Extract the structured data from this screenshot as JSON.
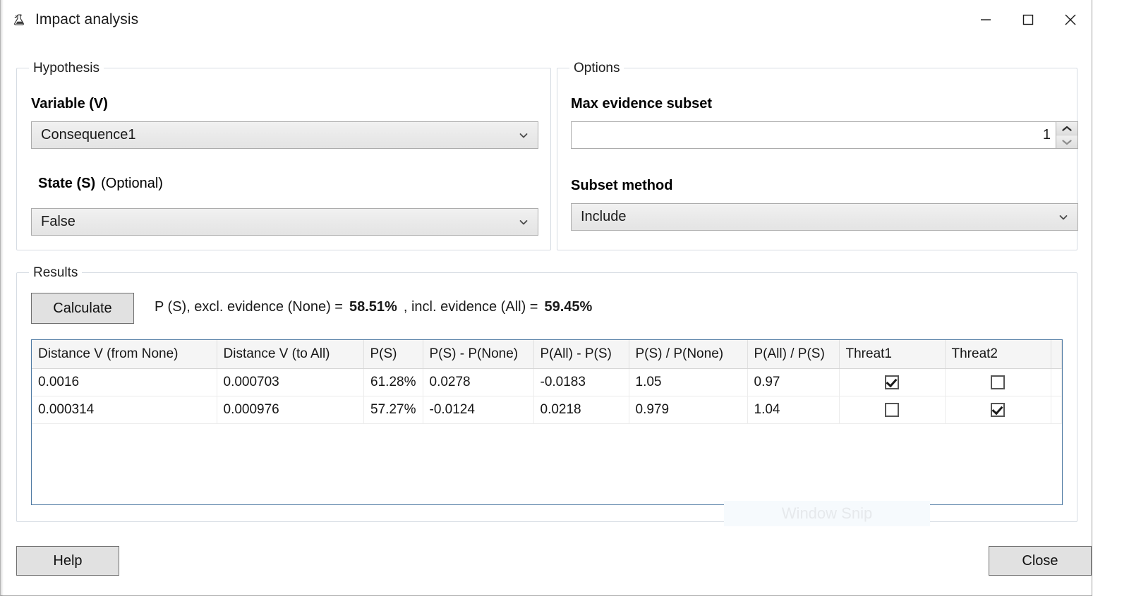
{
  "window": {
    "title": "Impact analysis",
    "icon": "flask-icon",
    "minimize_label": "Minimize",
    "maximize_label": "Maximize",
    "close_label": "Close"
  },
  "hypothesis": {
    "legend": "Hypothesis",
    "variable_label": "Variable (V)",
    "variable_value": "Consequence1",
    "state_label": "State (S)",
    "state_optional": "(Optional)",
    "state_value": "False"
  },
  "options": {
    "legend": "Options",
    "max_subset_label": "Max evidence subset",
    "max_subset_value": "1",
    "subset_method_label": "Subset method",
    "subset_method_value": "Include"
  },
  "results": {
    "legend": "Results",
    "calculate_label": "Calculate",
    "summary_prefix": "P (S), excl. evidence (None) =",
    "excl_value": "58.51%",
    "summary_middle": ", incl. evidence (All) =",
    "incl_value": "59.45%"
  },
  "table": {
    "columns": [
      "Distance V (from None)",
      "Distance V (to All)",
      "P(S)",
      "P(S) - P(None)",
      "P(All) - P(S)",
      "P(S) / P(None)",
      "P(All) / P(S)",
      "Threat1",
      "Threat2",
      ""
    ],
    "rows": [
      {
        "distance_from_none": "0.0016",
        "distance_to_all": "0.000703",
        "p_s": "61.28%",
        "p_s_minus_p_none": "0.0278",
        "p_all_minus_p_s": "-0.0183",
        "p_s_over_p_none": "1.05",
        "p_all_over_p_s": "0.97",
        "threat1": true,
        "threat2": false
      },
      {
        "distance_from_none": "0.000314",
        "distance_to_all": "0.000976",
        "p_s": "57.27%",
        "p_s_minus_p_none": "-0.0124",
        "p_all_minus_p_s": "0.0218",
        "p_s_over_p_none": "0.979",
        "p_all_over_p_s": "1.04",
        "threat1": false,
        "threat2": true
      }
    ]
  },
  "footer": {
    "help_label": "Help",
    "close_label": "Close"
  },
  "overlay": {
    "snip_label": "Window Snip"
  }
}
